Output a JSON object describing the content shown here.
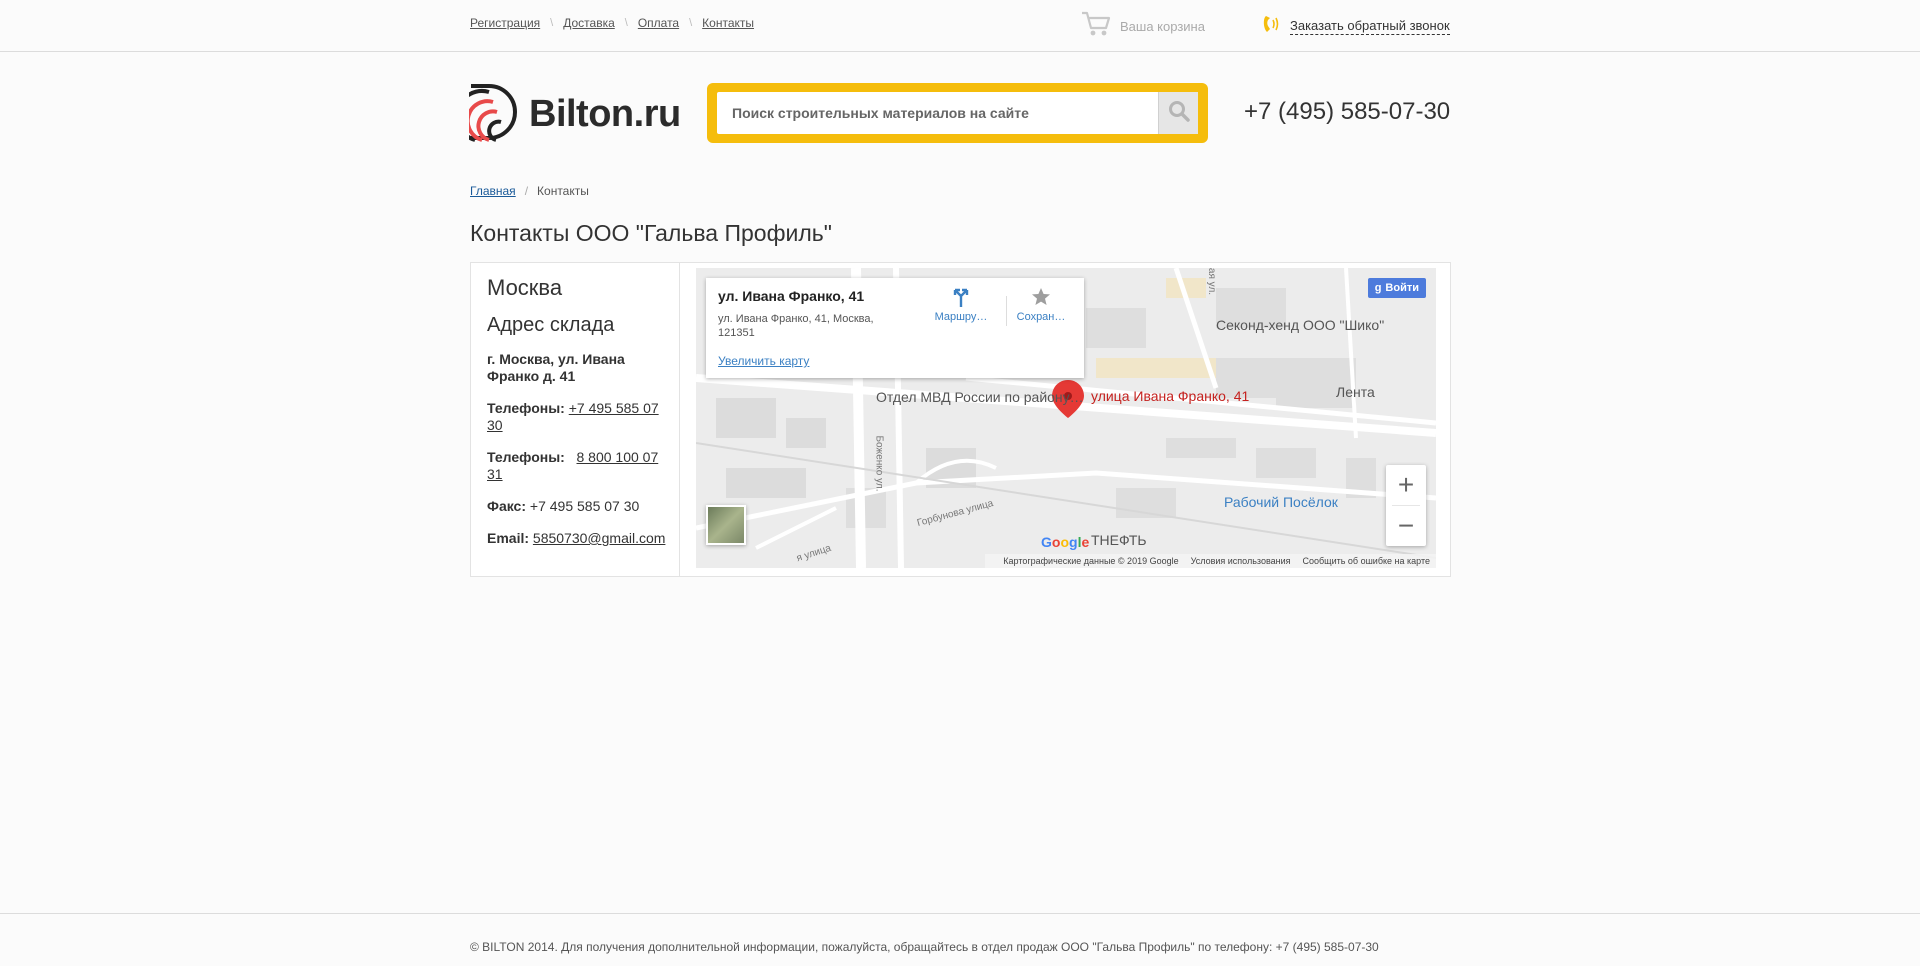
{
  "topnav": {
    "items": [
      "Регистрация",
      "Доставка",
      "Оплата",
      "Контакты"
    ]
  },
  "cart": {
    "label": "Ваша корзина"
  },
  "callback": {
    "label": "Заказать обратный звонок"
  },
  "logo": {
    "brand": "Bilton.ru"
  },
  "search": {
    "placeholder": "Поиск строительных материалов на сайте"
  },
  "phone": "+7 (495) 585-07-30",
  "breadcrumb": {
    "home": "Главная",
    "current": "Контакты"
  },
  "page_title": "Контакты ООО \"Гальва Профиль\"",
  "contacts": {
    "city": "Москва",
    "warehouse_heading": "Адрес склада",
    "address": "г. Москва, ул. Ивана Франко д. 41",
    "phone1_label": "Телефоны:",
    "phone1": "+7 495 585 07 30",
    "phone2_label": "Телефоны:",
    "phone2": "8 800 100 07 31",
    "fax_label": "Факс:",
    "fax": "+7 495 585 07 30",
    "email_label": "Email:",
    "email": "5850730@gmail.com"
  },
  "map": {
    "card_title": "ул. Ивана Франко, 41",
    "card_address": "ул. Ивана Франко, 41, Москва, 121351",
    "card_enlarge": "Увеличить карту",
    "action_route": "Маршру…",
    "action_save": "Сохран…",
    "signin": "Войти",
    "labels": {
      "shop": "Секонд-хенд ООО \"Шико\"",
      "lenta": "Лента",
      "marker": "улица Ивана Франко, 41",
      "mvd": "Отдел МВД России по району…",
      "rabochiy": "Рабочий Посёлок",
      "theft": "ТНЕФТЬ",
      "bozhenko": "Боженко ул.",
      "gorbunova": "Горбунова улица",
      "ulitsa": "я улица",
      "street_top": "ая ул."
    },
    "google": "Google",
    "attribution": {
      "data": "Картографические данные © 2019 Google",
      "terms": "Условия использования",
      "report": "Сообщить об ошибке на карте"
    },
    "zoom_in": "+",
    "zoom_out": "−"
  },
  "footer": {
    "text": "© BILTON 2014. Для получения дополнительной информации, пожалуйста, обращайтесь в отдел продаж ООО \"Гальва Профиль\" по телефону: +7 (495) 585-07-30"
  },
  "colors": {
    "accent_yellow": "#f5bd0c",
    "link_blue": "#1a5a99",
    "map_blue": "#3b80c3",
    "marker_red": "#e53935"
  }
}
